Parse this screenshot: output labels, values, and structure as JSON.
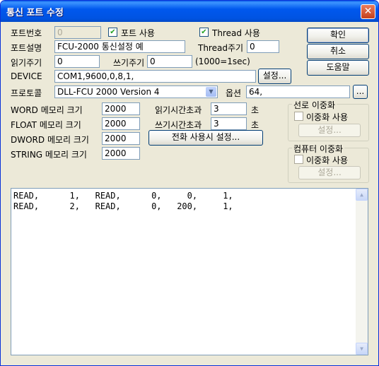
{
  "window": {
    "title": "통신 포트 수정",
    "close_glyph": "✕"
  },
  "form": {
    "port_no_label": "포트번호",
    "port_no_value": "0",
    "port_use_label": "포트 사용",
    "port_use_checked": "✔",
    "thread_use_label": "Thread 사용",
    "thread_use_checked": "✔",
    "port_desc_label": "포트설명",
    "port_desc_value": "FCU-2000 통신설정 예",
    "thread_period_label": "Thread주기",
    "thread_period_value": "0",
    "read_period_label": "읽기주기",
    "read_period_value": "0",
    "write_period_label": "쓰기주기",
    "write_period_value": "0",
    "period_unit": "(1000=1sec)",
    "device_label": "DEVICE",
    "device_value": "COM1,9600,0,8,1,",
    "settings_button": "설정...",
    "protocol_label": "프로토콜",
    "protocol_value": "DLL-FCU 2000 Version 4",
    "option_label": "옵션",
    "option_value": "64,",
    "option_button": "...",
    "word_mem_label": "WORD 메모리 크기",
    "word_mem_value": "2000",
    "float_mem_label": "FLOAT 메모리 크기",
    "float_mem_value": "2000",
    "dword_mem_label": "DWORD 메모리 크기",
    "dword_mem_value": "2000",
    "string_mem_label": "STRING 메모리 크기",
    "string_mem_value": "2000",
    "read_timeout_label": "읽기시간초과",
    "read_timeout_value": "3",
    "read_timeout_unit": "초",
    "write_timeout_label": "쓰기시간초과",
    "write_timeout_value": "3",
    "write_timeout_unit": "초",
    "phone_settings_button": "전화 사용시 설정..."
  },
  "buttons": {
    "ok": "확인",
    "cancel": "취소",
    "help": "도움말"
  },
  "line_redundancy": {
    "title": "선로 이중화",
    "use_label": "이중화 사용",
    "settings_button": "설정..."
  },
  "computer_redundancy": {
    "title": "컴퓨터 이중화",
    "use_label": "이중화 사용",
    "settings_button": "설정..."
  },
  "script_text": "READ,      1,   READ,      0,     0,     1,\nREAD,      2,   READ,      0,   200,     1,",
  "scrollbar": {
    "up_glyph": "▲",
    "down_glyph": "▼"
  },
  "combo_arrow_glyph": "▼"
}
